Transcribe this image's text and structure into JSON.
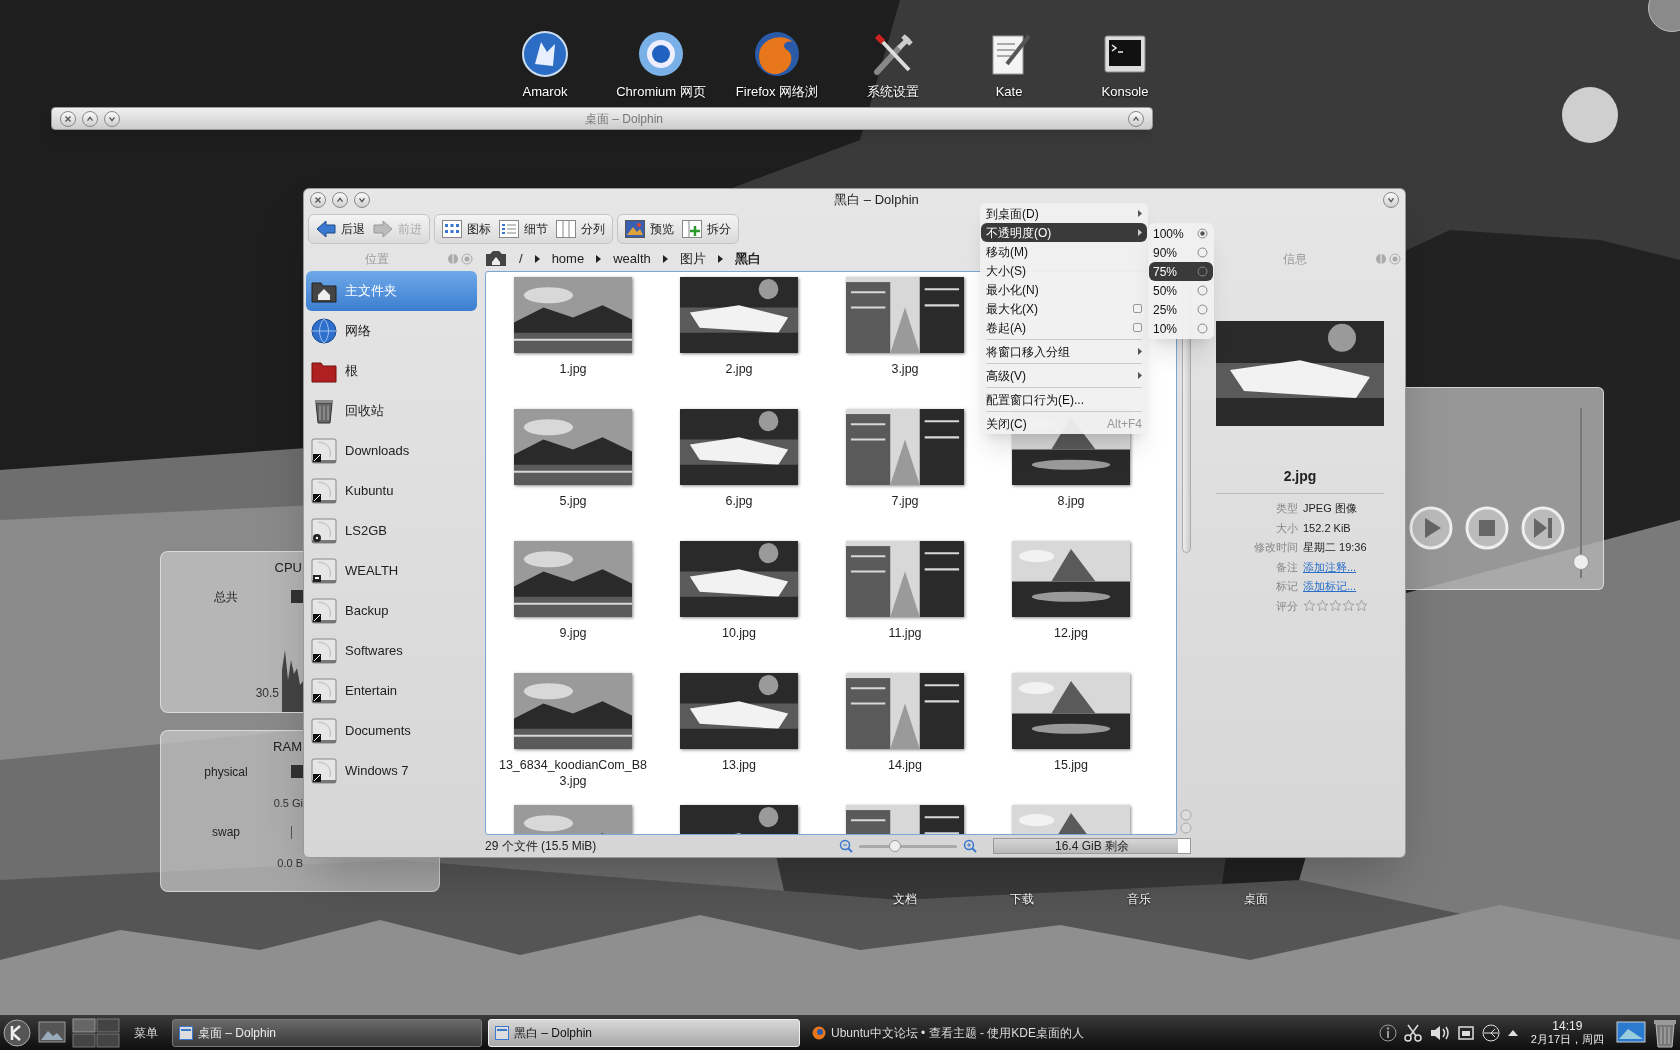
{
  "desktop_shortcuts": [
    {
      "label": "Amarok",
      "kind": "amarok"
    },
    {
      "label": "Chromium 网页",
      "kind": "chromium"
    },
    {
      "label": "Firefox 网络浏",
      "kind": "firefox"
    },
    {
      "label": "系统设置",
      "kind": "settings"
    },
    {
      "label": "Kate",
      "kind": "kate"
    },
    {
      "label": "Konsole",
      "kind": "konsole"
    }
  ],
  "shaded_window": {
    "title": "桌面 – Dolphin"
  },
  "cpu_widget": {
    "title": "CPU",
    "label": "总共",
    "reading": "30.5"
  },
  "ram_widget": {
    "title": "RAM",
    "rows": [
      {
        "label": "physical",
        "reading": "0.5 Gi"
      },
      {
        "label": "swap",
        "reading": "0.0 B"
      }
    ]
  },
  "media_widget": {
    "volume": {
      "level": 0.05
    }
  },
  "folder_labels": [
    "文档",
    "下载",
    "音乐",
    "桌面"
  ],
  "dolphin": {
    "title": "黑白 – Dolphin",
    "toolbar_groups": [
      {
        "items": [
          {
            "label": "后退",
            "kind": "back",
            "disabled": false
          },
          {
            "label": "前进",
            "kind": "forward",
            "disabled": true
          }
        ]
      },
      {
        "items": [
          {
            "label": "图标",
            "kind": "icons",
            "disabled": false
          },
          {
            "label": "细节",
            "kind": "details",
            "disabled": false
          },
          {
            "label": "分列",
            "kind": "columns",
            "disabled": false
          }
        ]
      },
      {
        "items": [
          {
            "label": "预览",
            "kind": "preview",
            "disabled": false
          },
          {
            "label": "拆分",
            "kind": "split",
            "disabled": false
          }
        ]
      }
    ],
    "places": {
      "title": "位置",
      "items": [
        {
          "label": "主文件夹",
          "kind": "home",
          "selected": true
        },
        {
          "label": "网络",
          "kind": "network",
          "selected": false
        },
        {
          "label": "根",
          "kind": "root",
          "selected": false
        },
        {
          "label": "回收站",
          "kind": "trash",
          "selected": false
        },
        {
          "label": "Downloads",
          "kind": "drive",
          "selected": false
        },
        {
          "label": "Kubuntu",
          "kind": "drive",
          "selected": false
        },
        {
          "label": "LS2GB",
          "kind": "disc",
          "selected": false
        },
        {
          "label": "WEALTH",
          "kind": "removable",
          "selected": false
        },
        {
          "label": "Backup",
          "kind": "drive",
          "selected": false
        },
        {
          "label": "Softwares",
          "kind": "drive",
          "selected": false
        },
        {
          "label": "Entertain",
          "kind": "drive",
          "selected": false
        },
        {
          "label": "Documents",
          "kind": "drive",
          "selected": false
        },
        {
          "label": "Windows 7",
          "kind": "drive",
          "selected": false
        }
      ]
    },
    "breadcrumb": [
      "/",
      "home",
      "wealth",
      "图片",
      "黑白"
    ],
    "files": [
      {
        "name": "1.jpg"
      },
      {
        "name": "2.jpg"
      },
      {
        "name": "3.jpg"
      },
      {
        "kind": "hidden"
      },
      {
        "name": "5.jpg"
      },
      {
        "name": "6.jpg"
      },
      {
        "name": "7.jpg"
      },
      {
        "name": "8.jpg"
      },
      {
        "name": "9.jpg"
      },
      {
        "name": "10.jpg"
      },
      {
        "name": "11.jpg"
      },
      {
        "name": "12.jpg"
      },
      {
        "name": "13_6834_koodianCom_B83.jpg"
      },
      {
        "name": "13.jpg"
      },
      {
        "name": "14.jpg"
      },
      {
        "name": "15.jpg"
      },
      {
        "kind": "picture"
      },
      {
        "kind": "picture"
      },
      {
        "kind": "picture"
      },
      {
        "kind": "picture"
      }
    ],
    "status": {
      "text": "29 个文件 (15.5 MiB)",
      "zoom": {
        "level": 0.35
      },
      "free_space": {
        "label": "16.4 GiB 剩余",
        "level": 0.94
      }
    },
    "info": {
      "title": "信息",
      "name": "2.jpg",
      "rows": [
        {
          "label": "类型",
          "kind": "text",
          "value": "JPEG 图像"
        },
        {
          "label": "大小",
          "kind": "text",
          "value": "152.2 KiB"
        },
        {
          "label": "修改时间",
          "kind": "text",
          "value": "星期二 19:36"
        },
        {
          "label": "备注",
          "kind": "link",
          "value": "添加注释..."
        },
        {
          "label": "标记",
          "kind": "link",
          "value": "添加标记..."
        },
        {
          "label": "评分",
          "kind": "rating",
          "stars": 0
        }
      ]
    }
  },
  "window_menu": {
    "items": [
      {
        "label": "到桌面(D)",
        "kind": "submenu",
        "selected": false
      },
      {
        "label": "不透明度(O)",
        "kind": "submenu",
        "selected": true
      },
      {
        "label": "移动(M)",
        "kind": "plain",
        "selected": false
      },
      {
        "label": "大小(S)",
        "kind": "plain",
        "selected": false
      },
      {
        "label": "最小化(N)",
        "kind": "plain",
        "selected": false
      },
      {
        "label": "最大化(X)",
        "kind": "check",
        "checked": false,
        "selected": false
      },
      {
        "label": "卷起(A)",
        "kind": "check",
        "checked": false,
        "selected": false
      },
      {
        "kind": "separator"
      },
      {
        "label": "将窗口移入分组",
        "kind": "submenu",
        "selected": false
      },
      {
        "kind": "separator"
      },
      {
        "label": "高级(V)",
        "kind": "submenu",
        "selected": false
      },
      {
        "kind": "separator"
      },
      {
        "label": "配置窗口行为(E)...",
        "kind": "plain",
        "selected": false
      },
      {
        "kind": "separator"
      },
      {
        "label": "关闭(C)",
        "kind": "plain",
        "shortcut": "Alt+F4",
        "selected": false
      }
    ]
  },
  "opacity_menu": {
    "items": [
      {
        "label": "100%",
        "checked": true,
        "selected": false
      },
      {
        "label": "90%",
        "checked": false,
        "selected": false
      },
      {
        "label": "75%",
        "checked": false,
        "selected": true
      },
      {
        "label": "50%",
        "checked": false,
        "selected": false
      },
      {
        "label": "25%",
        "checked": false,
        "selected": false
      },
      {
        "label": "10%",
        "checked": false,
        "selected": false
      }
    ]
  },
  "taskbar": {
    "menu_label": "菜单",
    "tasks": [
      {
        "label": "桌面 – Dolphin",
        "kind": "dolphin",
        "selected": false
      },
      {
        "label": "黑白 – Dolphin",
        "kind": "dolphin",
        "selected": true
      },
      {
        "label": "Ubuntu中文论坛 • 查看主题 - 使用KDE桌面的人",
        "kind": "firefox",
        "selected": false
      }
    ],
    "clock": {
      "time": "14:19",
      "date": "2月17日，周四"
    }
  }
}
